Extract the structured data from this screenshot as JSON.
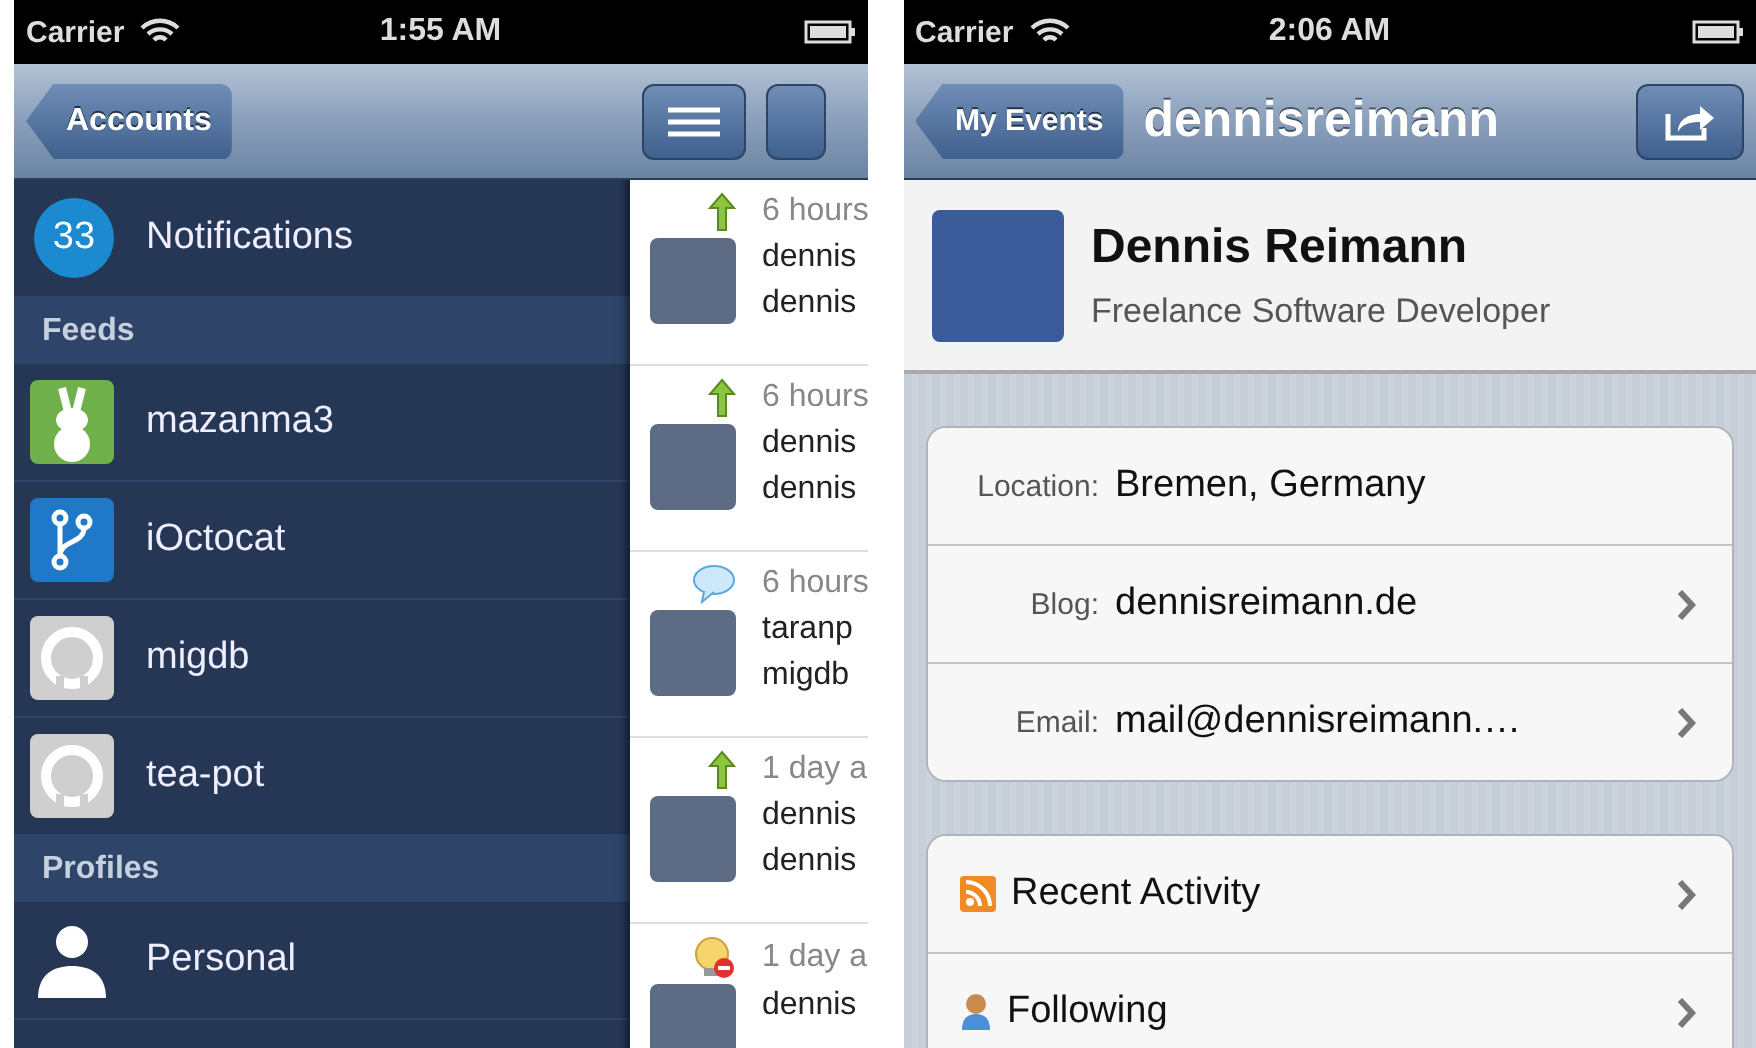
{
  "left_screen": {
    "status_bar": {
      "carrier": "Carrier",
      "time": "1:55 AM"
    },
    "nav": {
      "back_button": "Accounts"
    },
    "sidebar": {
      "notifications": {
        "count": "33",
        "label": "Notifications"
      },
      "sections": [
        {
          "title": "Feeds",
          "items": [
            {
              "label": "mazanma3",
              "kind": "rabbit"
            },
            {
              "label": "iOctocat",
              "kind": "branch"
            },
            {
              "label": "migdb",
              "kind": "octocat"
            },
            {
              "label": "tea-pot",
              "kind": "octocat"
            }
          ]
        },
        {
          "title": "Profiles",
          "items": [
            {
              "label": "Personal",
              "kind": "person"
            }
          ]
        }
      ]
    },
    "feed": [
      {
        "kind": "push",
        "time": "6 hours",
        "lines": [
          "dennis",
          "dennis"
        ]
      },
      {
        "kind": "push",
        "time": "6 hours",
        "lines": [
          "dennis",
          "dennis"
        ]
      },
      {
        "kind": "comment",
        "time": "6 hours",
        "lines": [
          "taranp",
          "migdb"
        ]
      },
      {
        "kind": "push",
        "time": "1 day a",
        "lines": [
          "dennis",
          "dennis"
        ]
      },
      {
        "kind": "issue",
        "time": "1 day a",
        "lines": [
          "dennis"
        ]
      }
    ]
  },
  "right_screen": {
    "status_bar": {
      "carrier": "Carrier",
      "time": "2:06 AM"
    },
    "nav": {
      "back_button": "My Events",
      "title": "dennisreimann"
    },
    "profile": {
      "name": "Dennis Reimann",
      "subtitle": "Freelance Software Developer"
    },
    "details": [
      {
        "label": "Location:",
        "value": "Bremen, Germany",
        "disclosure": false
      },
      {
        "label": "Blog:",
        "value": "dennisreimann.de",
        "disclosure": true
      },
      {
        "label": "Email:",
        "value": "mail@dennisreimann.…",
        "disclosure": true
      }
    ],
    "links": [
      {
        "label": "Recent Activity",
        "kind": "rss"
      },
      {
        "label": "Following",
        "kind": "person"
      }
    ]
  }
}
